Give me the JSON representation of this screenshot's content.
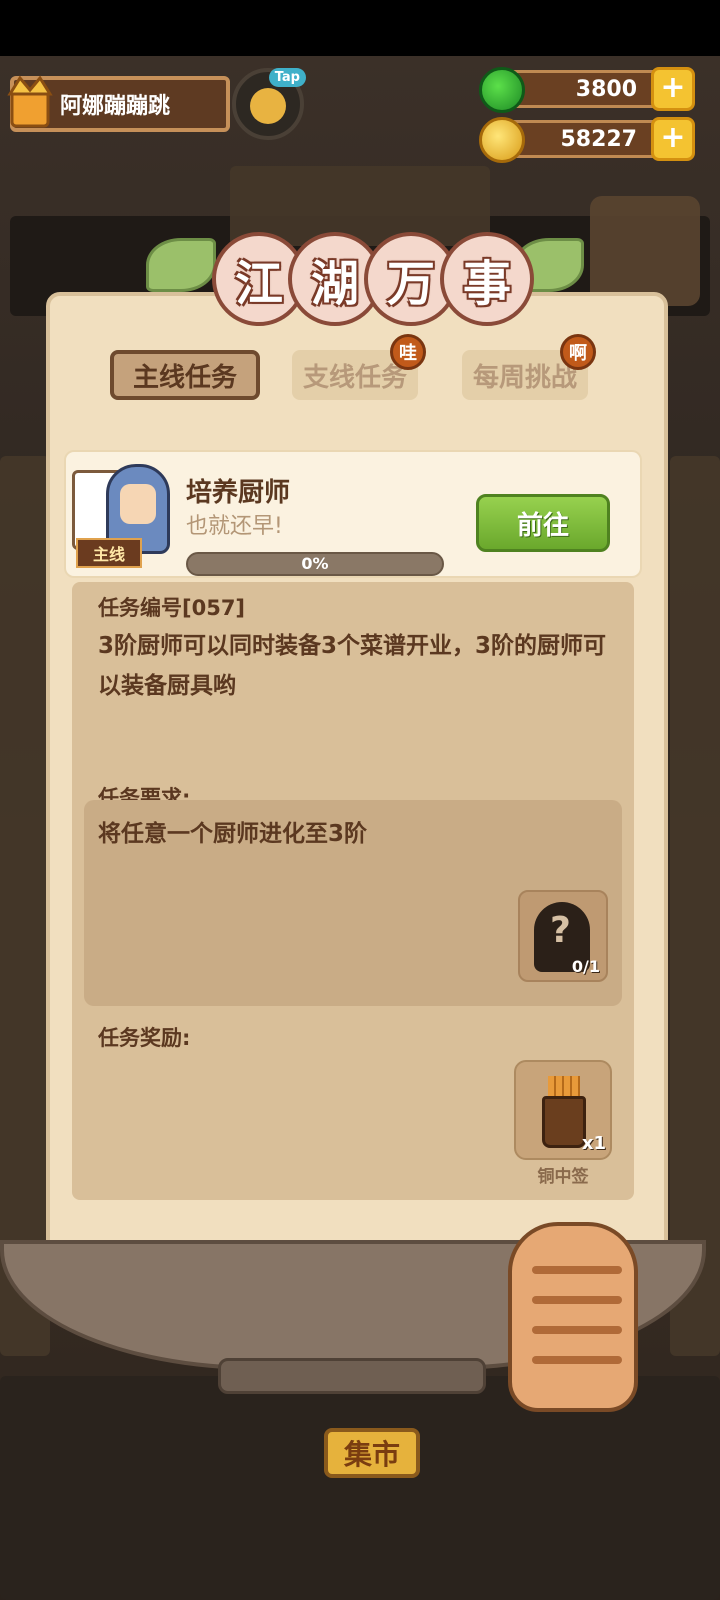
{
  "player": {
    "name": "阿娜蹦蹦跳",
    "tap_label": "Tap"
  },
  "currency": {
    "jade": "3800",
    "coins": "58227"
  },
  "panel": {
    "title_chars": [
      "江",
      "湖",
      "万",
      "事"
    ],
    "tabs": [
      {
        "label": "主线任务",
        "active": true,
        "badge": ""
      },
      {
        "label": "支线任务",
        "active": false,
        "badge": "哇"
      },
      {
        "label": "每周挑战",
        "active": false,
        "badge": "啊"
      }
    ]
  },
  "task": {
    "tag": "主线",
    "title": "培养厨师",
    "subtitle": "也就还早!",
    "progress_label": "0%",
    "progress": 0,
    "go_label": "前往",
    "id_label": "任务编号[057]",
    "description": "3阶厨师可以同时装备3个菜谱开业，3阶的厨师可以装备厨具哟",
    "requirement_label": "任务要求:",
    "requirement_text": "将任意一个厨师进化至3阶",
    "requirement_count": "0/1",
    "reward_label": "任务奖励:",
    "reward_count": "x1",
    "reward_name": "铜中签"
  },
  "background": {
    "market_label": "集市"
  },
  "colors": {
    "accent_green": "#7bc043",
    "panel_bg": "#f1dfbf",
    "text_brown": "#5b3820"
  }
}
